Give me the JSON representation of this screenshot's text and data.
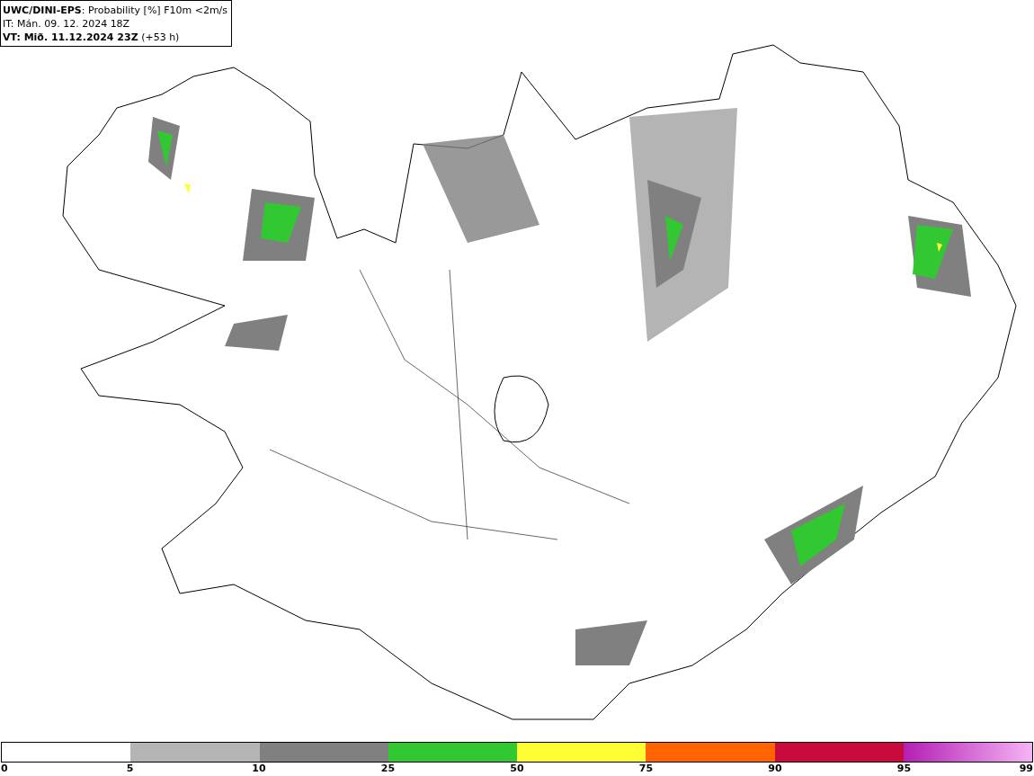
{
  "header": {
    "lines": [
      "**UWC/DINI-EPS**: Probability [%] F10m <2m/s",
      "IT: Mán. 09. 12. 2024 18Z",
      "**VT: Mið. 11.12.2024 23Z** (+53 h)"
    ]
  },
  "legend": {
    "segments": [
      {
        "kind": "blank"
      },
      {
        "color": "#b4b4b4"
      },
      {
        "color": "#808080"
      },
      {
        "color": "#32c832"
      },
      {
        "color": "#ffff32"
      },
      {
        "color": "#ff6400"
      },
      {
        "color": "#c80a3c"
      },
      {
        "kind": "gradient"
      }
    ],
    "ticks": [
      "0",
      "5",
      "10",
      "25",
      "50",
      "75",
      "90",
      "95",
      "99"
    ]
  }
}
